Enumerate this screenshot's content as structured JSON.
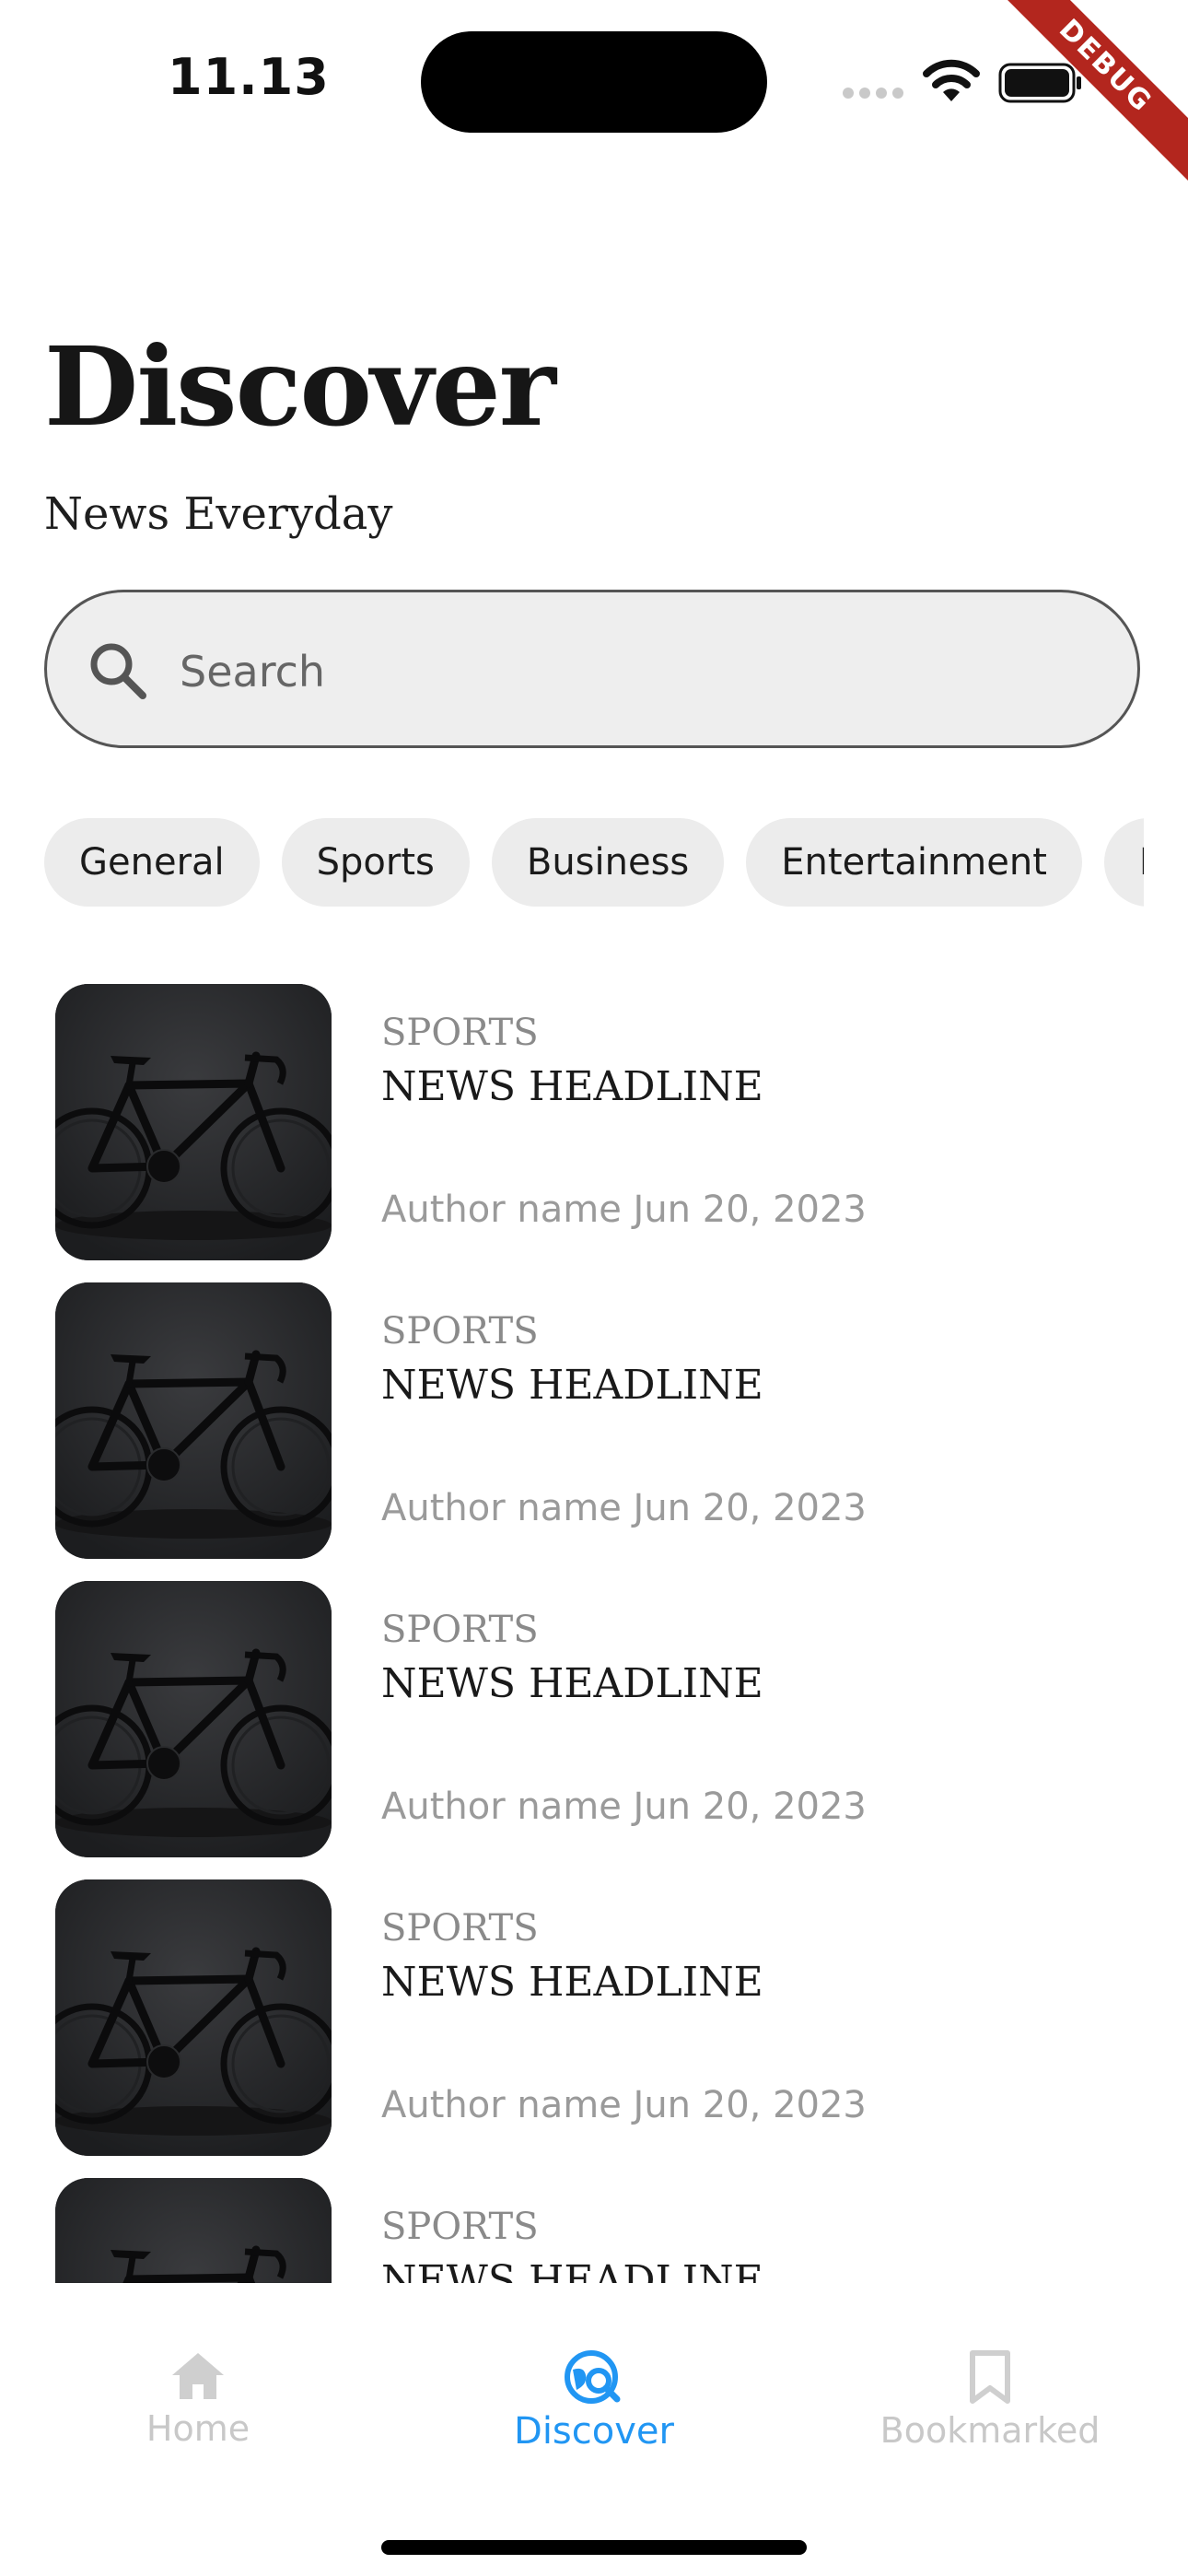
{
  "status_bar": {
    "time": "11.13",
    "debug_label": "DEBUG"
  },
  "header": {
    "title": "Discover",
    "subtitle": "News Everyday"
  },
  "search": {
    "placeholder": "Search",
    "value": ""
  },
  "categories": [
    "General",
    "Sports",
    "Business",
    "Entertainment",
    "H"
  ],
  "articles": [
    {
      "category": "SPORTS",
      "headline": "NEWS HEADLINE",
      "meta": "Author name Jun 20, 2023"
    },
    {
      "category": "SPORTS",
      "headline": "NEWS HEADLINE",
      "meta": "Author name Jun 20, 2023"
    },
    {
      "category": "SPORTS",
      "headline": "NEWS HEADLINE",
      "meta": "Author name Jun 20, 2023"
    },
    {
      "category": "SPORTS",
      "headline": "NEWS HEADLINE",
      "meta": "Author name Jun 20, 2023"
    },
    {
      "category": "SPORTS",
      "headline": "NEWS HEADLINE",
      "meta": ""
    }
  ],
  "bottom_nav": {
    "items": [
      {
        "label": "Home",
        "icon": "home-icon",
        "active": false
      },
      {
        "label": "Discover",
        "icon": "discover-icon",
        "active": true
      },
      {
        "label": "Bookmarked",
        "icon": "bookmark-icon",
        "active": false
      }
    ]
  },
  "colors": {
    "accent": "#2196f3",
    "inactive": "#c8c8c8",
    "chip_bg": "#ececec",
    "ribbon": "#b3261e"
  }
}
